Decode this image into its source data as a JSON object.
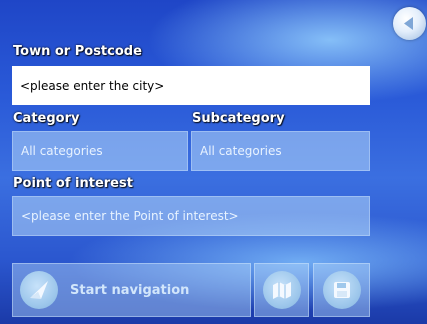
{
  "form": {
    "town_label": "Town or Postcode",
    "town_value": "<please enter the city>",
    "category_label": "Category",
    "category_value": "All categories",
    "subcategory_label": "Subcategory",
    "subcategory_value": "All categories",
    "poi_label": "Point of interest",
    "poi_placeholder": "<please enter the Point of interest>"
  },
  "buttons": {
    "back": "back-arrow-icon",
    "start_navigation": "Start navigation",
    "map": "map-icon",
    "save": "save-icon"
  }
}
